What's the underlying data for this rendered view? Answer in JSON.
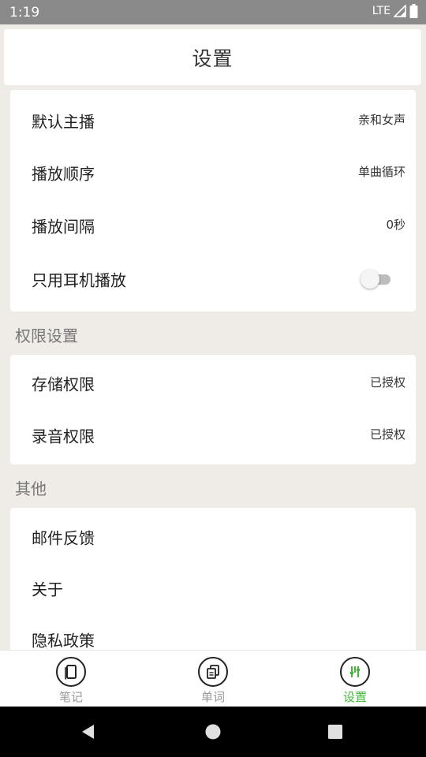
{
  "status_bar": {
    "time": "1:19",
    "network": "LTE"
  },
  "header": {
    "title": "设置"
  },
  "playback": {
    "items": [
      {
        "label": "默认主播",
        "value": "亲和女声"
      },
      {
        "label": "播放顺序",
        "value": "单曲循环"
      },
      {
        "label": "播放间隔",
        "value": "0秒"
      }
    ],
    "earphone_only": {
      "label": "只用耳机播放",
      "enabled": false
    }
  },
  "permissions": {
    "section_title": "权限设置",
    "items": [
      {
        "label": "存储权限",
        "value": "已授权"
      },
      {
        "label": "录音权限",
        "value": "已授权"
      }
    ]
  },
  "other": {
    "section_title": "其他",
    "items": [
      {
        "label": "邮件反馈"
      },
      {
        "label": "关于"
      },
      {
        "label": "隐私政策"
      }
    ]
  },
  "tabs": [
    {
      "label": "笔记",
      "icon": "notebook-icon",
      "active": false
    },
    {
      "label": "单词",
      "icon": "words-icon",
      "active": false
    },
    {
      "label": "设置",
      "icon": "settings-icon",
      "active": true
    }
  ],
  "colors": {
    "accent": "#3fb837",
    "background": "#efebe6",
    "status_bar": "#8a8a8a"
  }
}
